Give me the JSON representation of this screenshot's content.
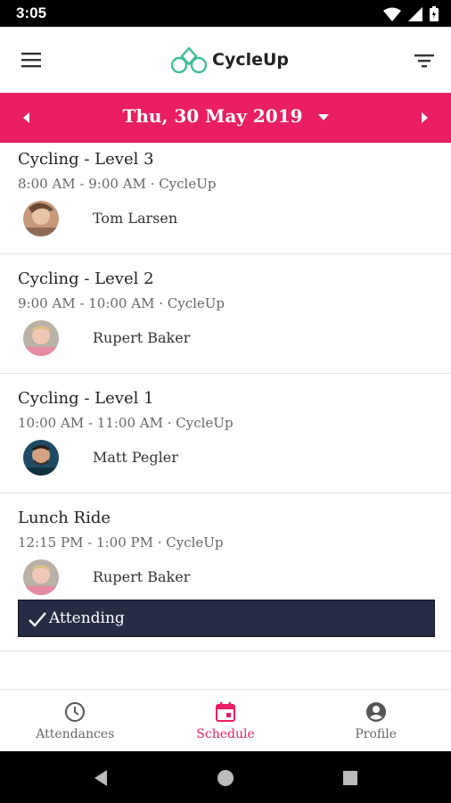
{
  "status_bar": {
    "time": "3:05"
  },
  "app_bar": {
    "brand": "CycleUp",
    "menu_icon": "hamburger-menu-icon",
    "filter_icon": "filter-icon"
  },
  "date_bar": {
    "date": "Thu, 30 May 2019"
  },
  "classes": [
    {
      "title": "Cycling - Level 3",
      "meta": "8:00 AM - 9:00 AM · CycleUp",
      "instructor": "Tom Larsen"
    },
    {
      "title": "Cycling - Level 2",
      "meta": "9:00 AM - 10:00 AM · CycleUp",
      "instructor": "Rupert Baker"
    },
    {
      "title": "Cycling - Level 1",
      "meta": "10:00 AM - 11:00 AM · CycleUp",
      "instructor": "Matt Pegler"
    },
    {
      "title": "Lunch Ride",
      "meta": "12:15 PM - 1:00 PM · CycleUp",
      "instructor": "Rupert Baker",
      "attending_label": "Attending"
    }
  ],
  "bottom_nav": [
    {
      "label": "Attendances"
    },
    {
      "label": "Schedule"
    },
    {
      "label": "Profile"
    }
  ],
  "colors": {
    "accent": "#e91e63",
    "brand_green": "#3fbf8f",
    "attending_bg": "#262c44"
  }
}
